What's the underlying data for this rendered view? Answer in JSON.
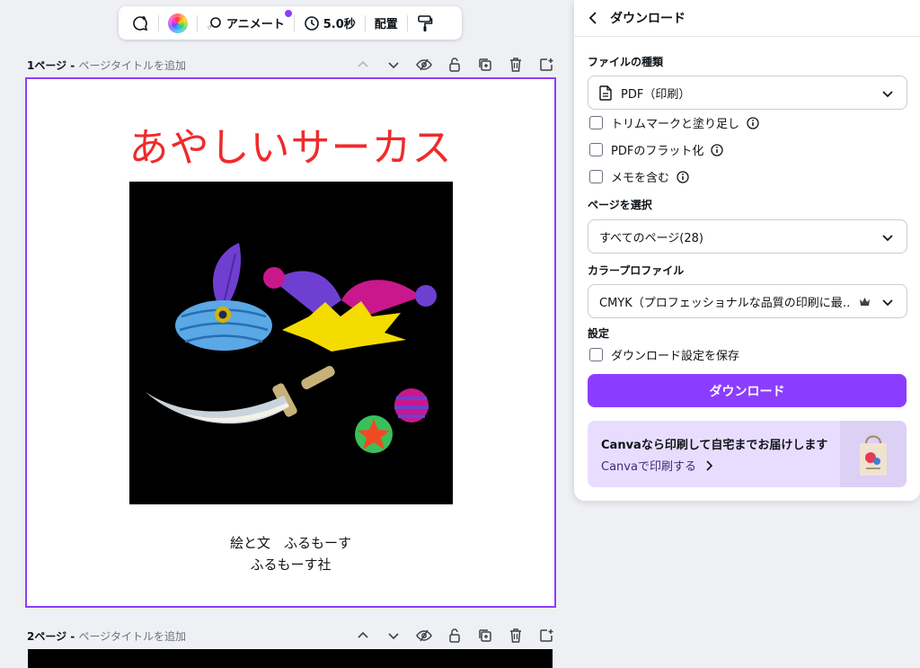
{
  "toolbar": {
    "animate_label": "アニメート",
    "duration_label": "5.0秒",
    "position_label": "配置"
  },
  "pages": [
    {
      "label": "1ページ - ",
      "title_placeholder": "ページタイトルを追加",
      "heading": "あやしいサーカス",
      "credit_line1": "絵と文　ふるもーす",
      "credit_line2": "ふるもーす社"
    },
    {
      "label": "2ページ - ",
      "title_placeholder": "ページタイトルを追加"
    }
  ],
  "panel": {
    "title": "ダウンロード",
    "file_type_label": "ファイルの種類",
    "file_type_value": "PDF（印刷）",
    "options": [
      {
        "label": "トリムマークと塗り足し",
        "checked": false
      },
      {
        "label": "PDFのフラット化",
        "checked": false
      },
      {
        "label": "メモを含む",
        "checked": false
      }
    ],
    "pages_label": "ページを選択",
    "pages_value": "すべてのページ(28)",
    "color_profile_label": "カラープロファイル",
    "color_profile_value": "CMYK（プロフェッショナルな品質の印刷に最…",
    "settings_label": "設定",
    "save_settings_label": "ダウンロード設定を保存",
    "download_button": "ダウンロード",
    "promo_title": "Canvaなら印刷して自宅までお届けします",
    "promo_link": "Canvaで印刷する"
  },
  "colors": {
    "accent": "#8b3dff",
    "title_red": "#ef2b2b",
    "promo_bg": "#e9ddff"
  }
}
